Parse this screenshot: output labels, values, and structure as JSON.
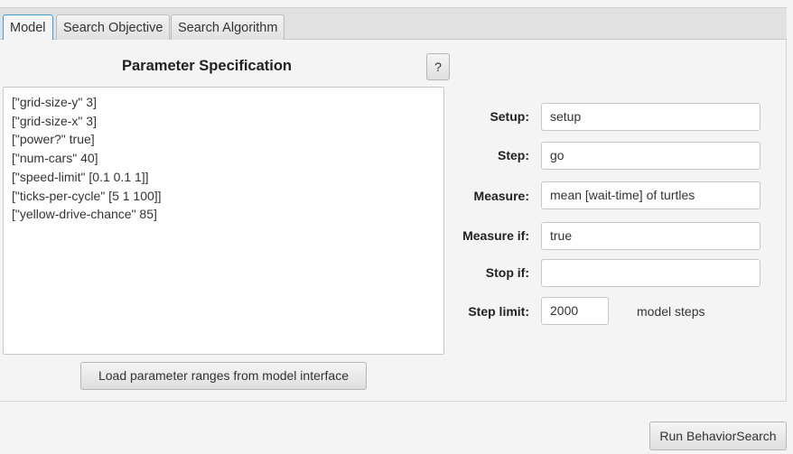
{
  "tabs": [
    {
      "label": "Model"
    },
    {
      "label": "Search Objective"
    },
    {
      "label": "Search Algorithm"
    }
  ],
  "param_spec": {
    "title": "Parameter Specification",
    "help_label": "?",
    "lines": [
      "[\"grid-size-y\" 3]",
      "[\"grid-size-x\" 3]",
      "[\"power?\" true]",
      "[\"num-cars\" 40]",
      "[\"speed-limit\" [0.1 0.1 1]]",
      "[\"ticks-per-cycle\" [5 1 100]]",
      "[\"yellow-drive-chance\" 85]"
    ],
    "load_button": "Load parameter ranges from model interface"
  },
  "form": {
    "setup_label": "Setup:",
    "setup": "setup",
    "step_label": "Step:",
    "step": "go",
    "measure_label": "Measure:",
    "measure": "mean [wait-time] of turtles",
    "measure_if_label": "Measure if:",
    "measure_if": "true",
    "stop_if_label": "Stop if:",
    "stop_if": "",
    "step_limit_label": "Step limit:",
    "step_limit": "2000",
    "step_limit_unit": "model steps"
  },
  "run_button": "Run BehaviorSearch"
}
